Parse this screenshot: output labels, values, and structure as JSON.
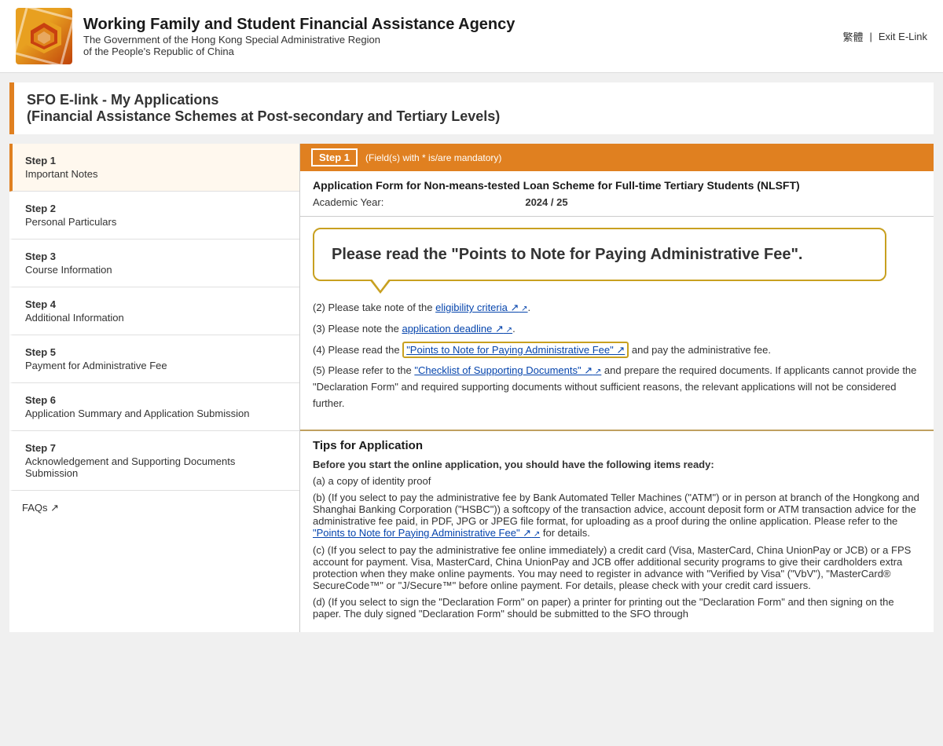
{
  "header": {
    "agency_name": "Working Family and Student Financial Assistance Agency",
    "agency_sub_line1": "The Government of the Hong Kong Special Administrative Region",
    "agency_sub_line2": "of the People's Republic of China",
    "lang_toggle": "繁體",
    "separator": "|",
    "exit_link": "Exit E-Link"
  },
  "page_title": {
    "line1": "SFO E-link - My Applications",
    "line2": "(Financial Assistance Schemes at Post-secondary and Tertiary Levels)"
  },
  "step_header": {
    "badge": "Step 1",
    "note": "(Field(s) with * is/are mandatory)"
  },
  "app_form": {
    "title": "Application Form for Non-means-tested Loan Scheme for Full-time Tertiary Students (NLSFT)",
    "year_label": "Academic Year:",
    "year_value": "2024 / 25"
  },
  "tooltip": {
    "text": "Please read the \"Points to Note for Paying Administrative Fee\"."
  },
  "content_items": [
    {
      "prefix": "(2)",
      "text": "Please take note of the ",
      "link_text": "eligibility criteria",
      "link_href": "#",
      "suffix": ".",
      "external": true
    },
    {
      "prefix": "(3)",
      "text": "Please note the ",
      "link_text": "application deadline",
      "link_href": "#",
      "suffix": ".",
      "external": true
    },
    {
      "prefix": "(4)",
      "text": "Please read the ",
      "link_text": "\"Points to Note for Paying Administrative Fee\"",
      "link_href": "#",
      "suffix": " and pay the administrative fee.",
      "external": true,
      "highlight": true
    },
    {
      "prefix": "(5)",
      "text": "Please refer to the ",
      "link_text": "\"Checklist of Supporting Documents\"",
      "link_href": "#",
      "suffix": " and prepare the required documents. If applicants cannot provide the \"Declaration Form\" and required supporting documents without sufficient reasons, the relevant applications will not be considered further.",
      "external": true
    }
  ],
  "tips": {
    "title": "Tips for Application",
    "intro": "Before you start the online application, you should have the following items ready:",
    "items": [
      {
        "prefix": "(a)",
        "text": "a copy of identity proof"
      },
      {
        "prefix": "(b)",
        "text": "(If you select to pay the administrative fee by Bank Automated Teller Machines (\"ATM\") or in person at branch of the Hongkong and Shanghai Banking Corporation (\"HSBC\")) a softcopy of the transaction advice, account deposit form or ATM transaction advice for the administrative fee paid, in PDF, JPG or JPEG file format, for uploading as a proof during the online application. Please refer to the ",
        "link_text": "\"Points to Note for Paying Administrative Fee\"",
        "link_href": "#",
        "suffix": " for details.",
        "external": true
      },
      {
        "prefix": "(c)",
        "text": "(If you select to pay the administrative fee online immediately) a credit card (Visa, MasterCard, China UnionPay or JCB) or a FPS account for payment. Visa, MasterCard, China UnionPay and JCB offer additional security programs to give their cardholders extra protection when they make online payments. You may need to register in advance with \"Verified by Visa\" (\"VbV\"), \"MasterCard® SecureCode™\" or \"J/Secure™\" before online payment. For details, please check with your credit card issuers."
      },
      {
        "prefix": "(d)",
        "text": "(If you select to sign the \"Declaration Form\" on paper) a printer for printing out the \"Declaration Form\" and then signing on the paper. The duly signed \"Declaration Form\" should be submitted to the SFO through"
      }
    ]
  },
  "sidebar": {
    "steps": [
      {
        "number": "Step 1",
        "label": "Important Notes",
        "active": true
      },
      {
        "number": "Step 2",
        "label": "Personal Particulars",
        "active": false
      },
      {
        "number": "Step 3",
        "label": "Course Information",
        "active": false
      },
      {
        "number": "Step 4",
        "label": "Additional Information",
        "active": false
      },
      {
        "number": "Step 5",
        "label": "Payment for Administrative Fee",
        "active": false
      },
      {
        "number": "Step 6",
        "label": "Application Summary and Application Submission",
        "active": false
      },
      {
        "number": "Step 7",
        "label": "Acknowledgement and Supporting Documents Submission",
        "active": false
      }
    ],
    "faqs_label": "FAQs ↗"
  }
}
